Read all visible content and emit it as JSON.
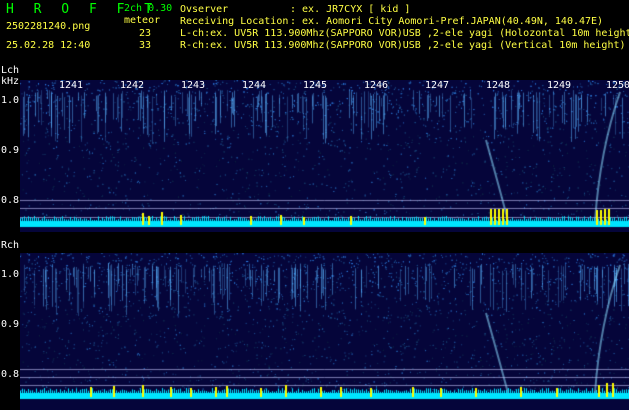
{
  "header": {
    "title": "H R O F F T",
    "filename": "2502281240.png",
    "datetime": "25.02.28 12:40",
    "mode": "2ch 0.30",
    "meteor_label": "meteor",
    "count_l": "23",
    "count_r": "33",
    "observer_label": "Ovserver",
    "observer_value": ": ex. JR7CYX [ kid ]",
    "location_label": "Receiving Location",
    "location_value": ": ex. Aomori City Aomori-Pref.JAPAN(40.49N, 140.47E)",
    "lch_desc": "L-ch:ex. UV5R 113.900Mhz(SAPPORO VOR)USB ,2-ele yagi (Holozontal 10m height)",
    "rch_desc": "R-ch:ex. UV5R 113.900Mhz(SAPPORO VOR)USB ,2-ele yagi (Vertical 10m height)"
  },
  "lch": {
    "label": "Lch",
    "unit": "kHz",
    "yticks": [
      "1.0",
      "0.9",
      "0.8"
    ],
    "time_ticks": [
      "1241",
      "1242",
      "1243",
      "1244",
      "1245",
      "1246",
      "1247",
      "1248",
      "1249",
      "1250"
    ]
  },
  "rch": {
    "label": "Rch",
    "yticks": [
      "1.0",
      "0.9",
      "0.8"
    ]
  },
  "colors": {
    "background": "#000000",
    "panel": "#05053a",
    "signal": "#00e5ff",
    "meteor": "#ffff00",
    "text_green": "#00ff00",
    "text_yellow": "#ffff44"
  }
}
